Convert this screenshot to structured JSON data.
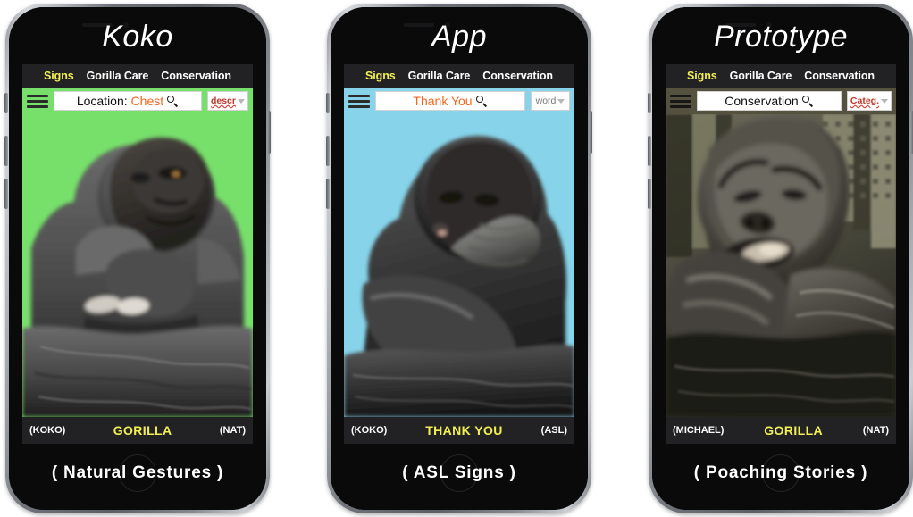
{
  "page": {
    "background": "#ffffff",
    "layout": "three-phone-mockup-row"
  },
  "palette": {
    "accent_yellow": "#f2ef53",
    "accent_orange": "#f4661e",
    "spellcheck_red": "#c0392b",
    "navbar_dark": "#222224",
    "bezel_black": "#0a0a0b",
    "screen1_background": "#77e06b",
    "screen2_background": "#87d4ea",
    "screen3_background": "#3c3a34"
  },
  "phones": [
    {
      "title": "Koko",
      "nav": [
        {
          "label": "Signs",
          "active": true
        },
        {
          "label": "Gorilla Care",
          "active": false
        },
        {
          "label": "Conservation",
          "active": false
        }
      ],
      "menu_icon": "hamburger-menu-icon",
      "search": {
        "prefix": "Location: ",
        "value": "Chest",
        "full_value": "Location: Chest",
        "icon": "search-icon"
      },
      "dropdown": {
        "label": "descr",
        "spellchecked": true,
        "icon": "chevron-down-icon"
      },
      "screen_background": "#77e06b",
      "caption_bar": {
        "left": "(KOKO)",
        "center": "GORILLA",
        "right": "(NAT)"
      },
      "bottom_caption": "( Natural Gestures )"
    },
    {
      "title": "App",
      "nav": [
        {
          "label": "Signs",
          "active": true
        },
        {
          "label": "Gorilla Care",
          "active": false
        },
        {
          "label": "Conservation",
          "active": false
        }
      ],
      "menu_icon": "hamburger-menu-icon",
      "search": {
        "prefix": "",
        "value": "Thank You",
        "full_value": "Thank You",
        "icon": "search-icon"
      },
      "dropdown": {
        "label": "word",
        "spellchecked": false,
        "icon": "chevron-down-icon"
      },
      "screen_background": "#87d4ea",
      "caption_bar": {
        "left": "(KOKO)",
        "center": "THANK YOU",
        "right": "(ASL)"
      },
      "bottom_caption": "( ASL Signs )"
    },
    {
      "title": "Prototype",
      "nav": [
        {
          "label": "Signs",
          "active": true
        },
        {
          "label": "Gorilla Care",
          "active": false
        },
        {
          "label": "Conservation",
          "active": false
        }
      ],
      "menu_icon": "hamburger-menu-icon",
      "search": {
        "prefix": "",
        "value": "Conservation",
        "full_value": "Conservation",
        "icon": "search-icon"
      },
      "dropdown": {
        "label": "Categ.",
        "spellchecked": true,
        "icon": "chevron-down-icon"
      },
      "screen_background": "#3c3a34",
      "caption_bar": {
        "left": "(MICHAEL)",
        "center": "GORILLA",
        "right": "(NAT)"
      },
      "bottom_caption": "( Poaching Stories )"
    }
  ]
}
